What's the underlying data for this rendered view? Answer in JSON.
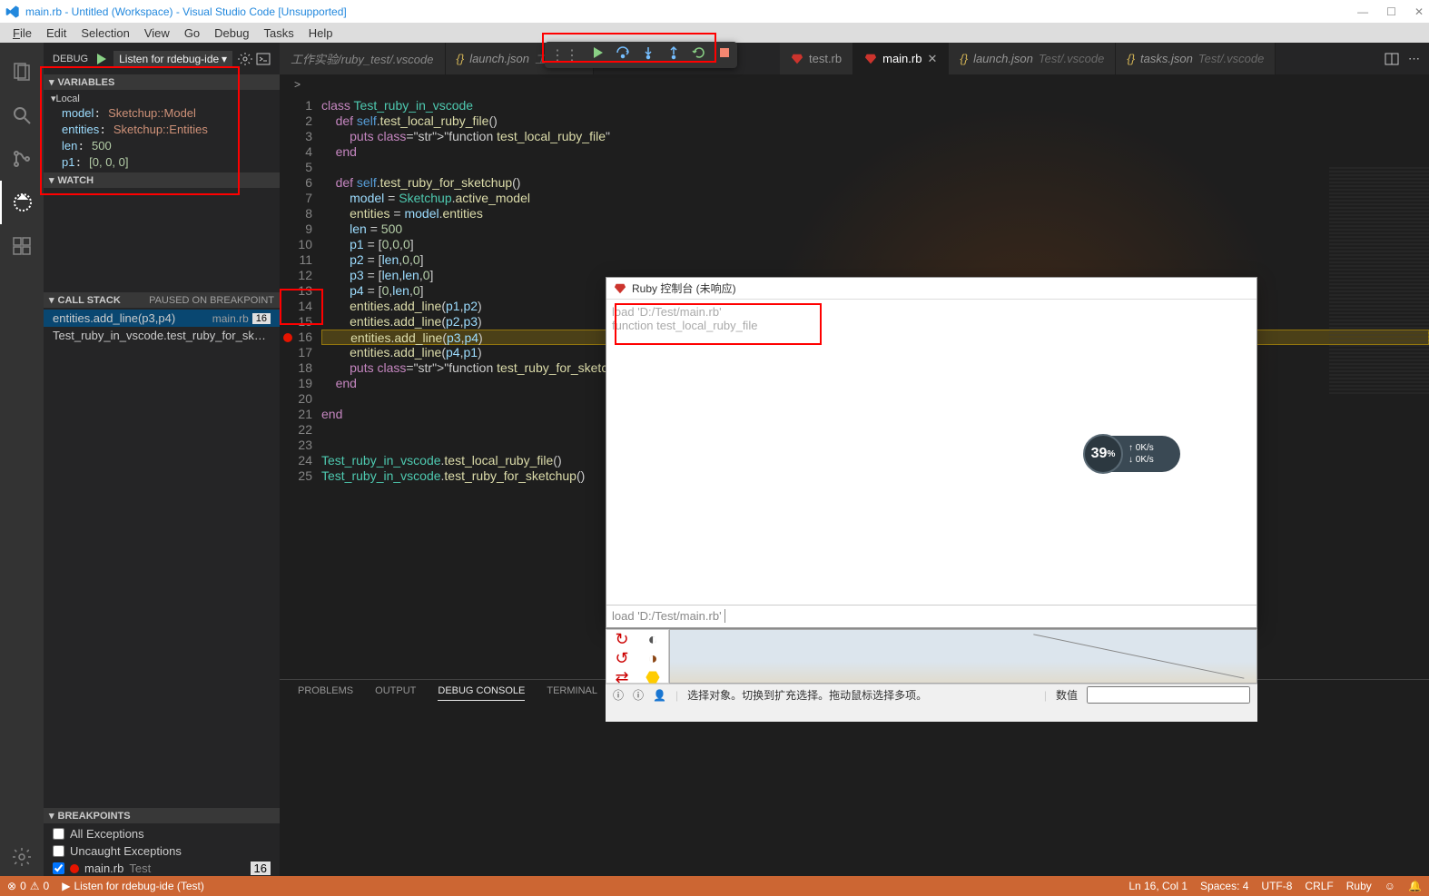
{
  "title": "main.rb - Untitled (Workspace) - Visual Studio Code [Unsupported]",
  "menubar": [
    "File",
    "Edit",
    "Selection",
    "View",
    "Go",
    "Debug",
    "Tasks",
    "Help"
  ],
  "debug": {
    "label": "DEBUG",
    "config": "Listen for rdebug-ide",
    "variables_section": "VARIABLES",
    "watch_section": "WATCH",
    "callstack_section": "CALL STACK",
    "callstack_status": "PAUSED ON BREAKPOINT",
    "breakpoints_section": "BREAKPOINTS",
    "local_label": "Local",
    "vars": {
      "model": {
        "name": "model",
        "value": "Sketchup::Model"
      },
      "entities": {
        "name": "entities",
        "value": "Sketchup::Entities"
      },
      "len": {
        "name": "len",
        "value": "500"
      },
      "p1": {
        "name": "p1",
        "value": "[0, 0, 0]"
      }
    },
    "callstack": [
      {
        "frame": "entities.add_line(p3,p4)",
        "file": "main.rb",
        "line": "16"
      },
      {
        "frame": "Test_ruby_in_vscode.test_ruby_for_sketchup",
        "file": "",
        "line": ""
      }
    ],
    "breakpoints": {
      "all_exceptions": "All Exceptions",
      "uncaught_exceptions": "Uncaught Exceptions",
      "main_rb": "main.rb",
      "main_rb_sub": "Test",
      "main_rb_line": "16"
    }
  },
  "tabs": {
    "breadcrumb": "工作实验/ruby_test/.vscode",
    "launch": "launch.json",
    "launch_sub": "工作实验",
    "test": "test.rb",
    "main": "main.rb",
    "launch2": "launch.json",
    "launch2_sub": "Test/.vscode",
    "tasks": "tasks.json",
    "tasks_sub": "Test/.vscode"
  },
  "code": {
    "lines": [
      "class Test_ruby_in_vscode",
      "    def self.test_local_ruby_file()",
      "        puts \"function test_local_ruby_file\"",
      "    end",
      "",
      "    def self.test_ruby_for_sketchup()",
      "        model = Sketchup.active_model",
      "        entities = model.entities",
      "        len = 500",
      "        p1 = [0,0,0]",
      "        p2 = [len,0,0]",
      "        p3 = [len,len,0]",
      "        p4 = [0,len,0]",
      "        entities.add_line(p1,p2)",
      "        entities.add_line(p2,p3)",
      "        entities.add_line(p3,p4)",
      "        entities.add_line(p4,p1)",
      "        puts \"function test_ruby_for_sketchup\"",
      "    end",
      "",
      "end",
      "",
      "",
      "Test_ruby_in_vscode.test_local_ruby_file()",
      "Test_ruby_in_vscode.test_ruby_for_sketchup()"
    ],
    "first_line": 1,
    "current_line": 16
  },
  "panel": {
    "problems": "PROBLEMS",
    "output": "OUTPUT",
    "debug_console": "DEBUG CONSOLE",
    "terminal": "TERMINAL"
  },
  "ruby_console": {
    "title": "Ruby 控制台 (未响应)",
    "line1": "load 'D:/Test/main.rb'",
    "line2": "function test_local_ruby_file",
    "input": "load 'D:/Test/main.rb'"
  },
  "sketchup": {
    "status": "选择对象。切换到扩充选择。拖动鼠标选择多项。",
    "value_label": "数值"
  },
  "speed": {
    "pct": "39",
    "up": "0K/s",
    "down": "0K/s"
  },
  "statusbar": {
    "errors": "0",
    "warnings": "0",
    "debug_config": "Listen for rdebug-ide (Test)",
    "pos": "Ln 16, Col 1",
    "spaces": "Spaces: 4",
    "encoding": "UTF-8",
    "eol": "CRLF",
    "lang": "Ruby"
  }
}
